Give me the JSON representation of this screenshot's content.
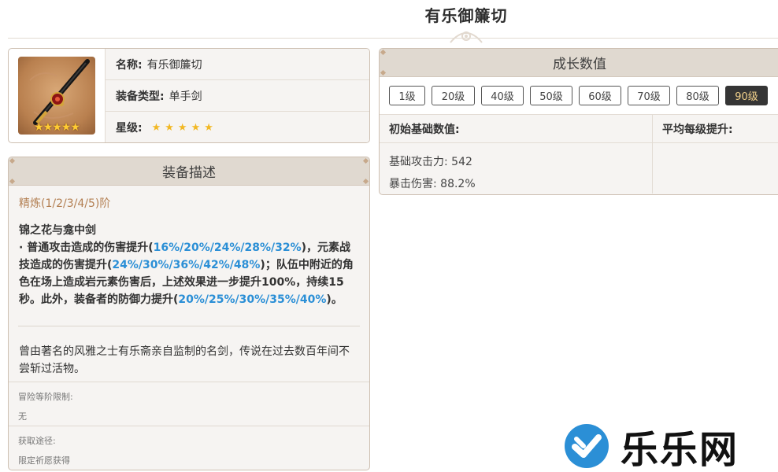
{
  "page": {
    "title": "有乐御簾切"
  },
  "info": {
    "name_key": "名称:",
    "name_value": "有乐御簾切",
    "type_key": "装备类型:",
    "type_value": "单手剑",
    "rarity_key": "星级:",
    "rarity_stars": 5,
    "rarity_display": "★★★★★",
    "thumb_stars": "★★★★★"
  },
  "description": {
    "header": "装备描述",
    "refine": "精炼(1/2/3/4/5)阶",
    "passive_name": "锦之花与龛中剑",
    "passive_p1": "· 普通攻击造成的伤害提升(",
    "passive_h1": "16%/20%/24%/28%/32%",
    "passive_p2": ")，元素战技造成的伤害提升(",
    "passive_h2": "24%/30%/36%/42%/48%",
    "passive_p3": ")；队伍中附近的角色在场上造成岩元素伤害后，上述效果进一步提升100%，持续15秒。此外，装备者的防御力提升(",
    "passive_h3": "20%/25%/30%/35%/40%",
    "passive_p4": ")。",
    "lore": "曾由著名的风雅之士有乐斋亲自监制的名剑，传说在过去数百年间不尝斩过活物。",
    "ascension_label": "冒险等阶限制:",
    "ascension_value": "无",
    "source_label": "获取途径:",
    "source_value": "限定祈愿获得"
  },
  "growth": {
    "header": "成长数值",
    "levels": [
      "1级",
      "20级",
      "40级",
      "50级",
      "60级",
      "70级",
      "80级",
      "90级"
    ],
    "active_level": "90级",
    "col_base": "初始基础数值:",
    "col_per_level": "平均每级提升:",
    "stat1": "基础攻击力: 542",
    "stat2": "暴击伤害: 88.2%"
  },
  "watermark": {
    "text": "乐乐网"
  },
  "colors": {
    "accent_blue": "#2b8fd6",
    "refine_brown": "#b37f52",
    "star_gold": "#f2b824",
    "header_bg": "#e0d9d0",
    "active_level_bg": "#353535",
    "watermark_blue": "#2b8fd6"
  },
  "icons": [
    "weapon-thumbnail",
    "star-icon",
    "emblem-icon",
    "checkmark-logo-icon"
  ]
}
